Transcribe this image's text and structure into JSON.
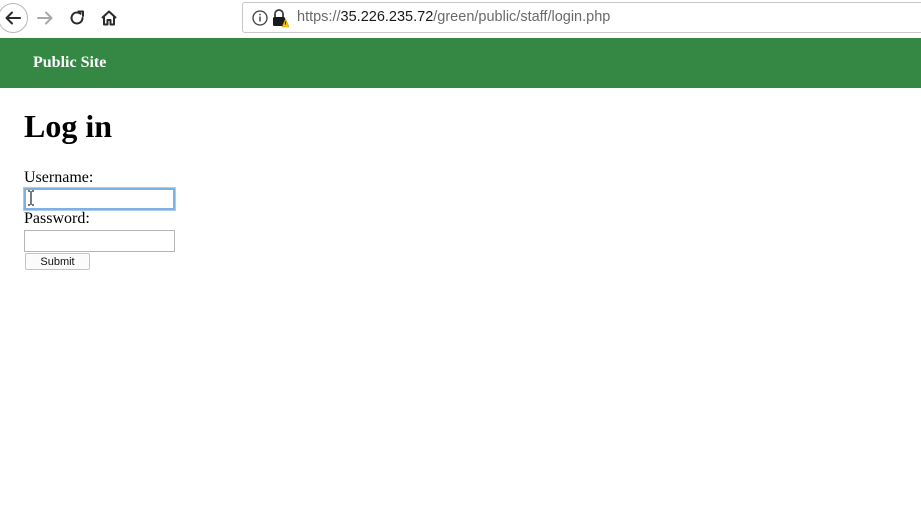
{
  "browser": {
    "url_prefix": "https://",
    "url_host": "35.226.235.72",
    "url_path": "/green/public/staff/login.php"
  },
  "site_header": {
    "link_label": "Public Site",
    "bg_color": "#358844"
  },
  "main": {
    "title": "Log in",
    "username_label": "Username:",
    "username_value": "",
    "password_label": "Password:",
    "password_value": "",
    "submit_label": "Submit"
  },
  "icons": [
    "back-arrow-icon",
    "forward-arrow-icon",
    "reload-icon",
    "home-icon",
    "info-icon",
    "insecure-lock-icon",
    "text-cursor-icon"
  ]
}
